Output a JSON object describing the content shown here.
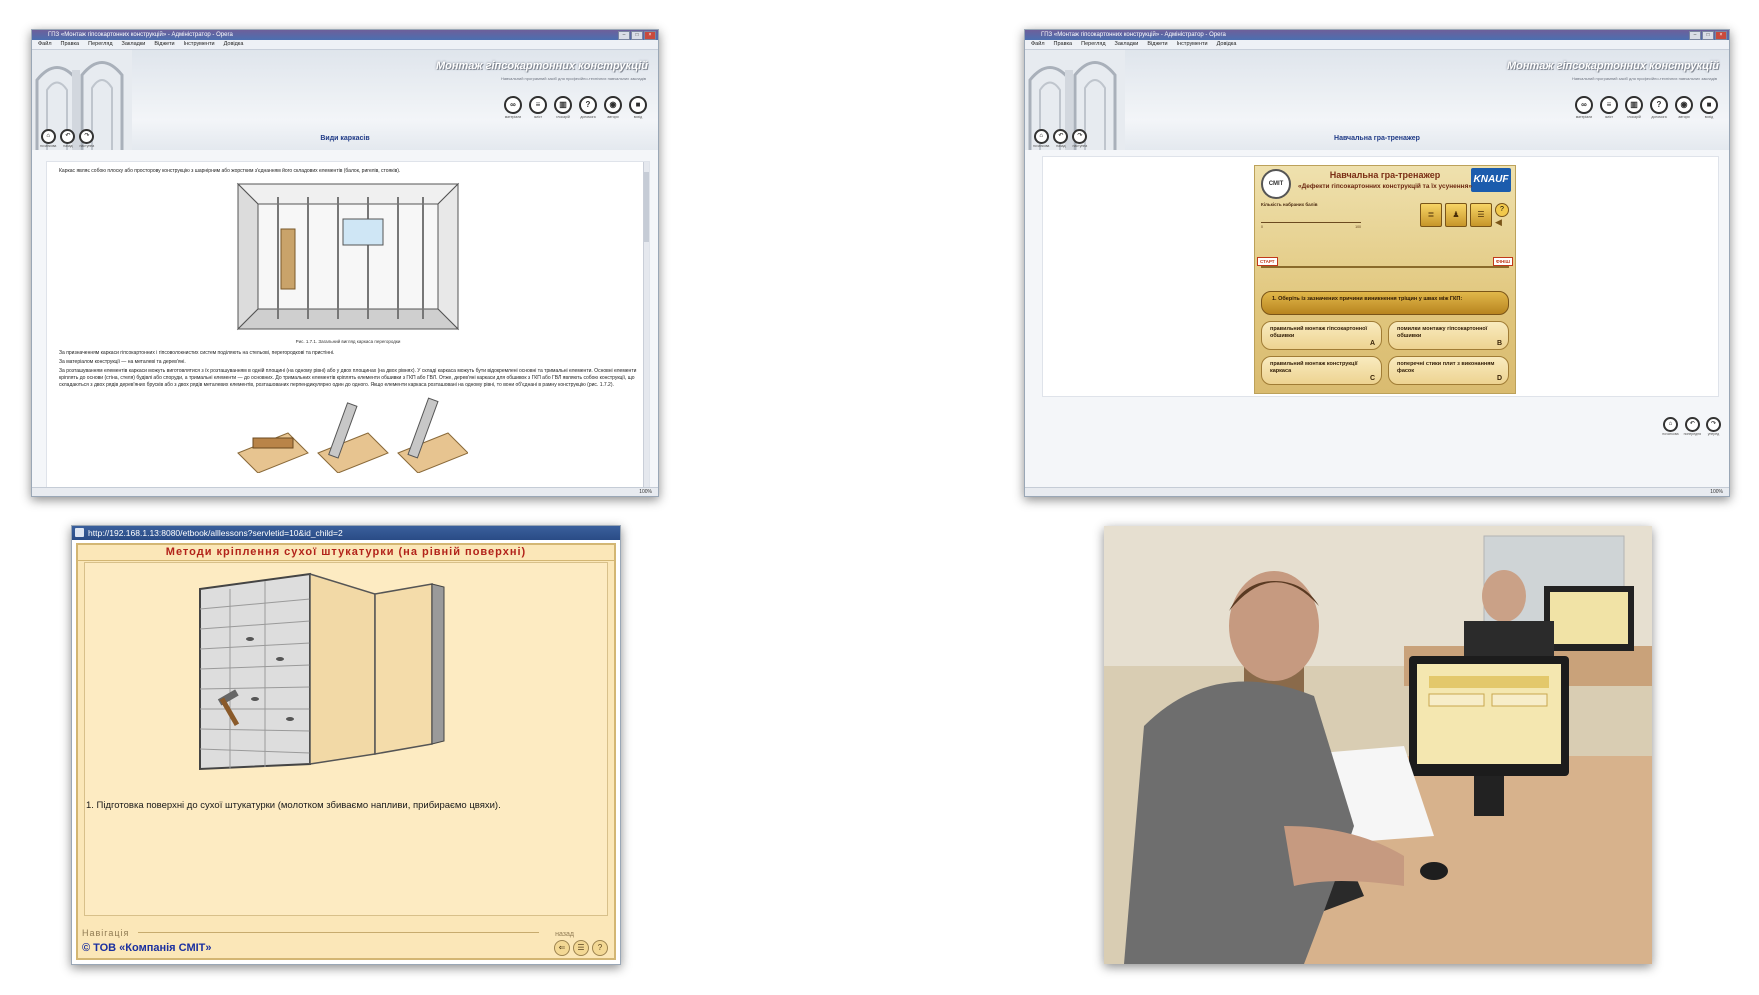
{
  "windows": {
    "ebook1": {
      "title": "ГПЗ «Монтаж гіпсокартонних конструкцій» - Адміністратор - Opera",
      "menu": [
        "Файл",
        "Правка",
        "Перегляд",
        "Закладки",
        "Віджети",
        "Інструменти",
        "Довідка"
      ],
      "brand": "Монтаж гіпсокартонних конструкцій",
      "brand_subtitle": "Навчальний програмний засіб для професійно-технічних навчальних закладів",
      "tools": [
        {
          "icon": "glasses-icon",
          "label": "матеріали"
        },
        {
          "icon": "list-icon",
          "label": "зміст"
        },
        {
          "icon": "book-icon",
          "label": "глосарій"
        },
        {
          "icon": "help-icon",
          "label": "допомога"
        },
        {
          "icon": "author-icon",
          "label": "автори"
        },
        {
          "icon": "exit-icon",
          "label": "вихід"
        }
      ],
      "nav": [
        {
          "icon": "home-icon",
          "label": "початкова"
        },
        {
          "icon": "back-icon",
          "label": "назад"
        },
        {
          "icon": "forward-icon",
          "label": "наступна"
        }
      ],
      "page_heading": "Види каркасів",
      "intro": "Каркас являє собою плоску або просторову конструкцію з шарнірним або жорстким з'єднанням його складових елементів (балок, ригелів, стояків).",
      "figure_caption": "Рис. 1.7.1. Загальний вигляд каркаса перегородки",
      "paragraphs": [
        "За призначенням каркаси гіпсокартонних і гіпсоволокнистих систем поділяють на стельові, перегородкові та пристінні.",
        "За матеріалом конструкції — на металеві та дерев'яні.",
        "За розташуванням елементів каркаси можуть виготовлятися з їх розташуванням в одній площині (на одному рівні) або у двох площинах (на двох рівнях). У складі каркаса можуть бути відокремлені основні та тримальні елементи. Основні елементи кріплять до основи (стіна, стеля) будівлі або споруди, а тримальні елементи — до основних. До тримальних елементів кріплять елементи обшивки з ГКП або ГВЛ. Отже, дерев'яні каркаси для обшивок з ГКП або ГВЛ являють собою конструкції, що складаються з двох рядів дерев'яних брусків або з двох рядів металевих елементів, розташованих перпендикулярно один до одного. Якщо елементи каркаса розташовані на одному рівні, то вони об'єднані в рамну конструкцію (рис. 1.7.2)."
      ],
      "status": "100%"
    },
    "ebook2": {
      "title": "ГПЗ «Монтаж гіпсокартонних конструкцій» - Адміністратор - Opera",
      "menu": [
        "Файл",
        "Правка",
        "Перегляд",
        "Закладки",
        "Віджети",
        "Інструменти",
        "Довідка"
      ],
      "brand": "Монтаж гіпсокартонних конструкцій",
      "brand_subtitle": "Навчальний програмний засіб для професійно-технічних навчальних закладів",
      "page_heading": "Навчальна гра-тренажер",
      "game": {
        "title": "Навчальна гра-тренажер",
        "subtitle": "«Дефекти гіпсокартонних конструкцій та їх усунення»",
        "logo_left": "СМІТ",
        "logo_right": "KNAUF",
        "score_label": "Кількість набраних балів",
        "scale_start": "0",
        "scale_end": "100",
        "start": "СТАРТ",
        "finish": "ФІНІШ",
        "question": "1. Оберіть із зазначених причини виникнення тріщин у швах між ГКП:",
        "answers": [
          {
            "text": "правильний монтаж гіпсокартонної обшивки",
            "letter": "A"
          },
          {
            "text": "помилки монтажу гіпсокартонної обшивки",
            "letter": "B"
          },
          {
            "text": "правильний монтаж конструкції каркаса",
            "letter": "C"
          },
          {
            "text": "поперечні стики плит з виконанням фасок",
            "letter": "D"
          }
        ]
      },
      "bottom_nav": [
        {
          "icon": "home-icon",
          "label": "початкова"
        },
        {
          "icon": "back-icon",
          "label": "попередня"
        },
        {
          "icon": "forward-icon",
          "label": "уперед"
        }
      ],
      "status": "100%"
    },
    "lesson": {
      "url": "http://192.168.1.13:8080/etbook/alllessons?servletid=10&id_child=2",
      "title": "Методи кріплення сухої штукатурки (на рівній поверхні)",
      "caption": "1. Підготовка поверхні до сухої штукатурки (молотком збиваємо напливи, прибираємо цвяхи).",
      "nav_label": "Навігація",
      "back_label": "назад",
      "copyright": "© ТОВ «Компанія СМІТ»"
    }
  },
  "colors": {
    "heading_blue": "#1f3a86",
    "lesson_red": "#b2231a",
    "lesson_bg": "#fbe7b8",
    "copyright_blue": "#1a2fa0",
    "knauf_blue": "#1b5cad"
  }
}
